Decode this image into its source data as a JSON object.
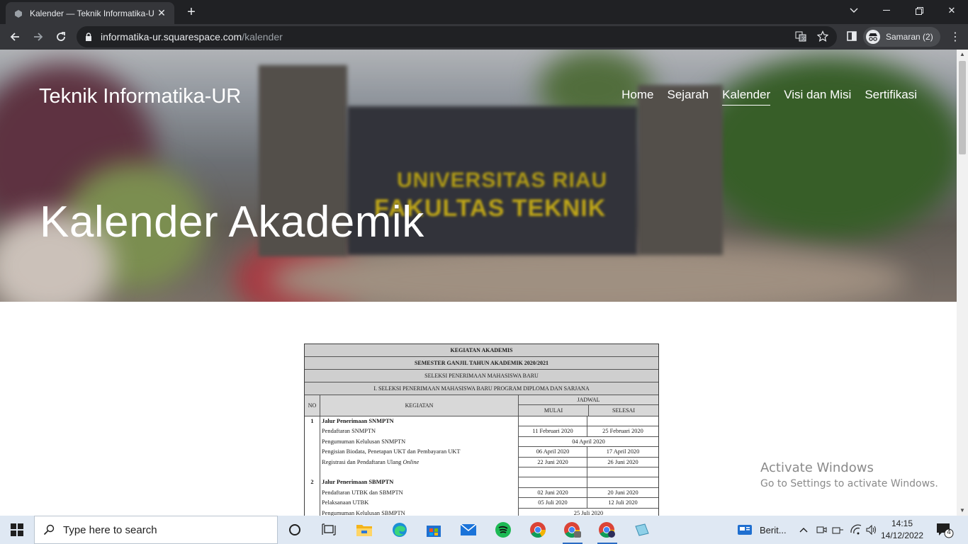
{
  "browser": {
    "tab_title": "Kalender — Teknik Informatika-U",
    "url_host": "informatika-ur.squarespace.com",
    "url_path": "/kalender",
    "profile_label": "Samaran (2)"
  },
  "site": {
    "title": "Teknik Informatika-UR",
    "nav": [
      {
        "label": "Home",
        "active": false
      },
      {
        "label": "Sejarah",
        "active": false
      },
      {
        "label": "Kalender",
        "active": true
      },
      {
        "label": "Visi dan Misi",
        "active": false
      },
      {
        "label": "Sertifikasi",
        "active": false
      }
    ],
    "hero_title": "Kalender Akademik",
    "hero_sign_line1": "UNIVERSITAS RIAU",
    "hero_sign_line2": "FAKULTAS TEKNIK"
  },
  "document": {
    "title1": "KEGIATAN AKADEMIS",
    "title2": "SEMESTER GANJIL TAHUN AKADEMIK 2020/2021",
    "title3": "SELEKSI PENERIMAAN MAHASISWA BARU",
    "title4": "I. SELEKSI PENERIMAAN MAHASISWA BARU PROGRAM DIPLOMA DAN SARJANA",
    "col_no": "NO",
    "col_kegiatan": "KEGIATAN",
    "col_jadwal": "JADWAL",
    "col_mulai": "MULAI",
    "col_selesai": "SELESAI",
    "rows": [
      {
        "no": "1",
        "kegiatan": "Jalur Penerimaan SNMPTN",
        "bold": true,
        "mulai": "",
        "selesai": "",
        "span": ""
      },
      {
        "no": "",
        "kegiatan": "Pendaftaran SNMPTN",
        "bold": false,
        "mulai": "11 Februari 2020",
        "selesai": "25  Februari 2020",
        "span": ""
      },
      {
        "no": "",
        "kegiatan": "Pengumuman Kelulusan SNMPTN",
        "bold": false,
        "mulai": "",
        "selesai": "",
        "span": "04 April 2020"
      },
      {
        "no": "",
        "kegiatan": "Pengisian Biodata, Penetapan UKT dan Pembayaran UKT",
        "bold": false,
        "mulai": "06 April 2020",
        "selesai": "17 April 2020",
        "span": ""
      },
      {
        "no": "",
        "kegiatan": "Registrasi dan Pendaftaran Ulang Online",
        "bold": false,
        "mulai": "22 Juni 2020",
        "selesai": "26 Juni 2020",
        "span": ""
      },
      {
        "no": "",
        "kegiatan": "",
        "bold": false,
        "mulai": "",
        "selesai": "",
        "span": ""
      },
      {
        "no": "2",
        "kegiatan": "Jalur Penerimaan SBMPTN",
        "bold": true,
        "mulai": "",
        "selesai": "",
        "span": ""
      },
      {
        "no": "",
        "kegiatan": "Pendaftaran UTBK dan SBMPTN",
        "bold": false,
        "mulai": "02 Juni  2020",
        "selesai": "20 Juni  2020",
        "span": ""
      },
      {
        "no": "",
        "kegiatan": "Pelaksanaan UTBK",
        "bold": false,
        "mulai": "05 Juli 2020",
        "selesai": "12 Juli  2020",
        "span": ""
      },
      {
        "no": "",
        "kegiatan": "Pengumuman Kelulusan SBMPTN",
        "bold": false,
        "mulai": "",
        "selesai": "",
        "span": "25 Juli 2020"
      }
    ]
  },
  "watermark": {
    "line1": "Activate Windows",
    "line2": "Go to Settings to activate Windows."
  },
  "taskbar": {
    "search_placeholder": "Type here to search",
    "news_label": "Berit...",
    "time": "14:15",
    "date": "14/12/2022",
    "notification_count": "4",
    "apps": [
      "task-view-icon",
      "file-explorer-icon",
      "edge-icon",
      "store-icon",
      "mail-icon",
      "spotify-icon",
      "chrome-icon",
      "chrome-profile-icon",
      "chrome-incognito-icon",
      "notes-icon"
    ]
  },
  "colors": {
    "chrome_dark": "#202124",
    "chrome_toolbar": "#35363a",
    "taskbar": "#dfe8f3",
    "hero_sign": "#d9bd1c"
  }
}
